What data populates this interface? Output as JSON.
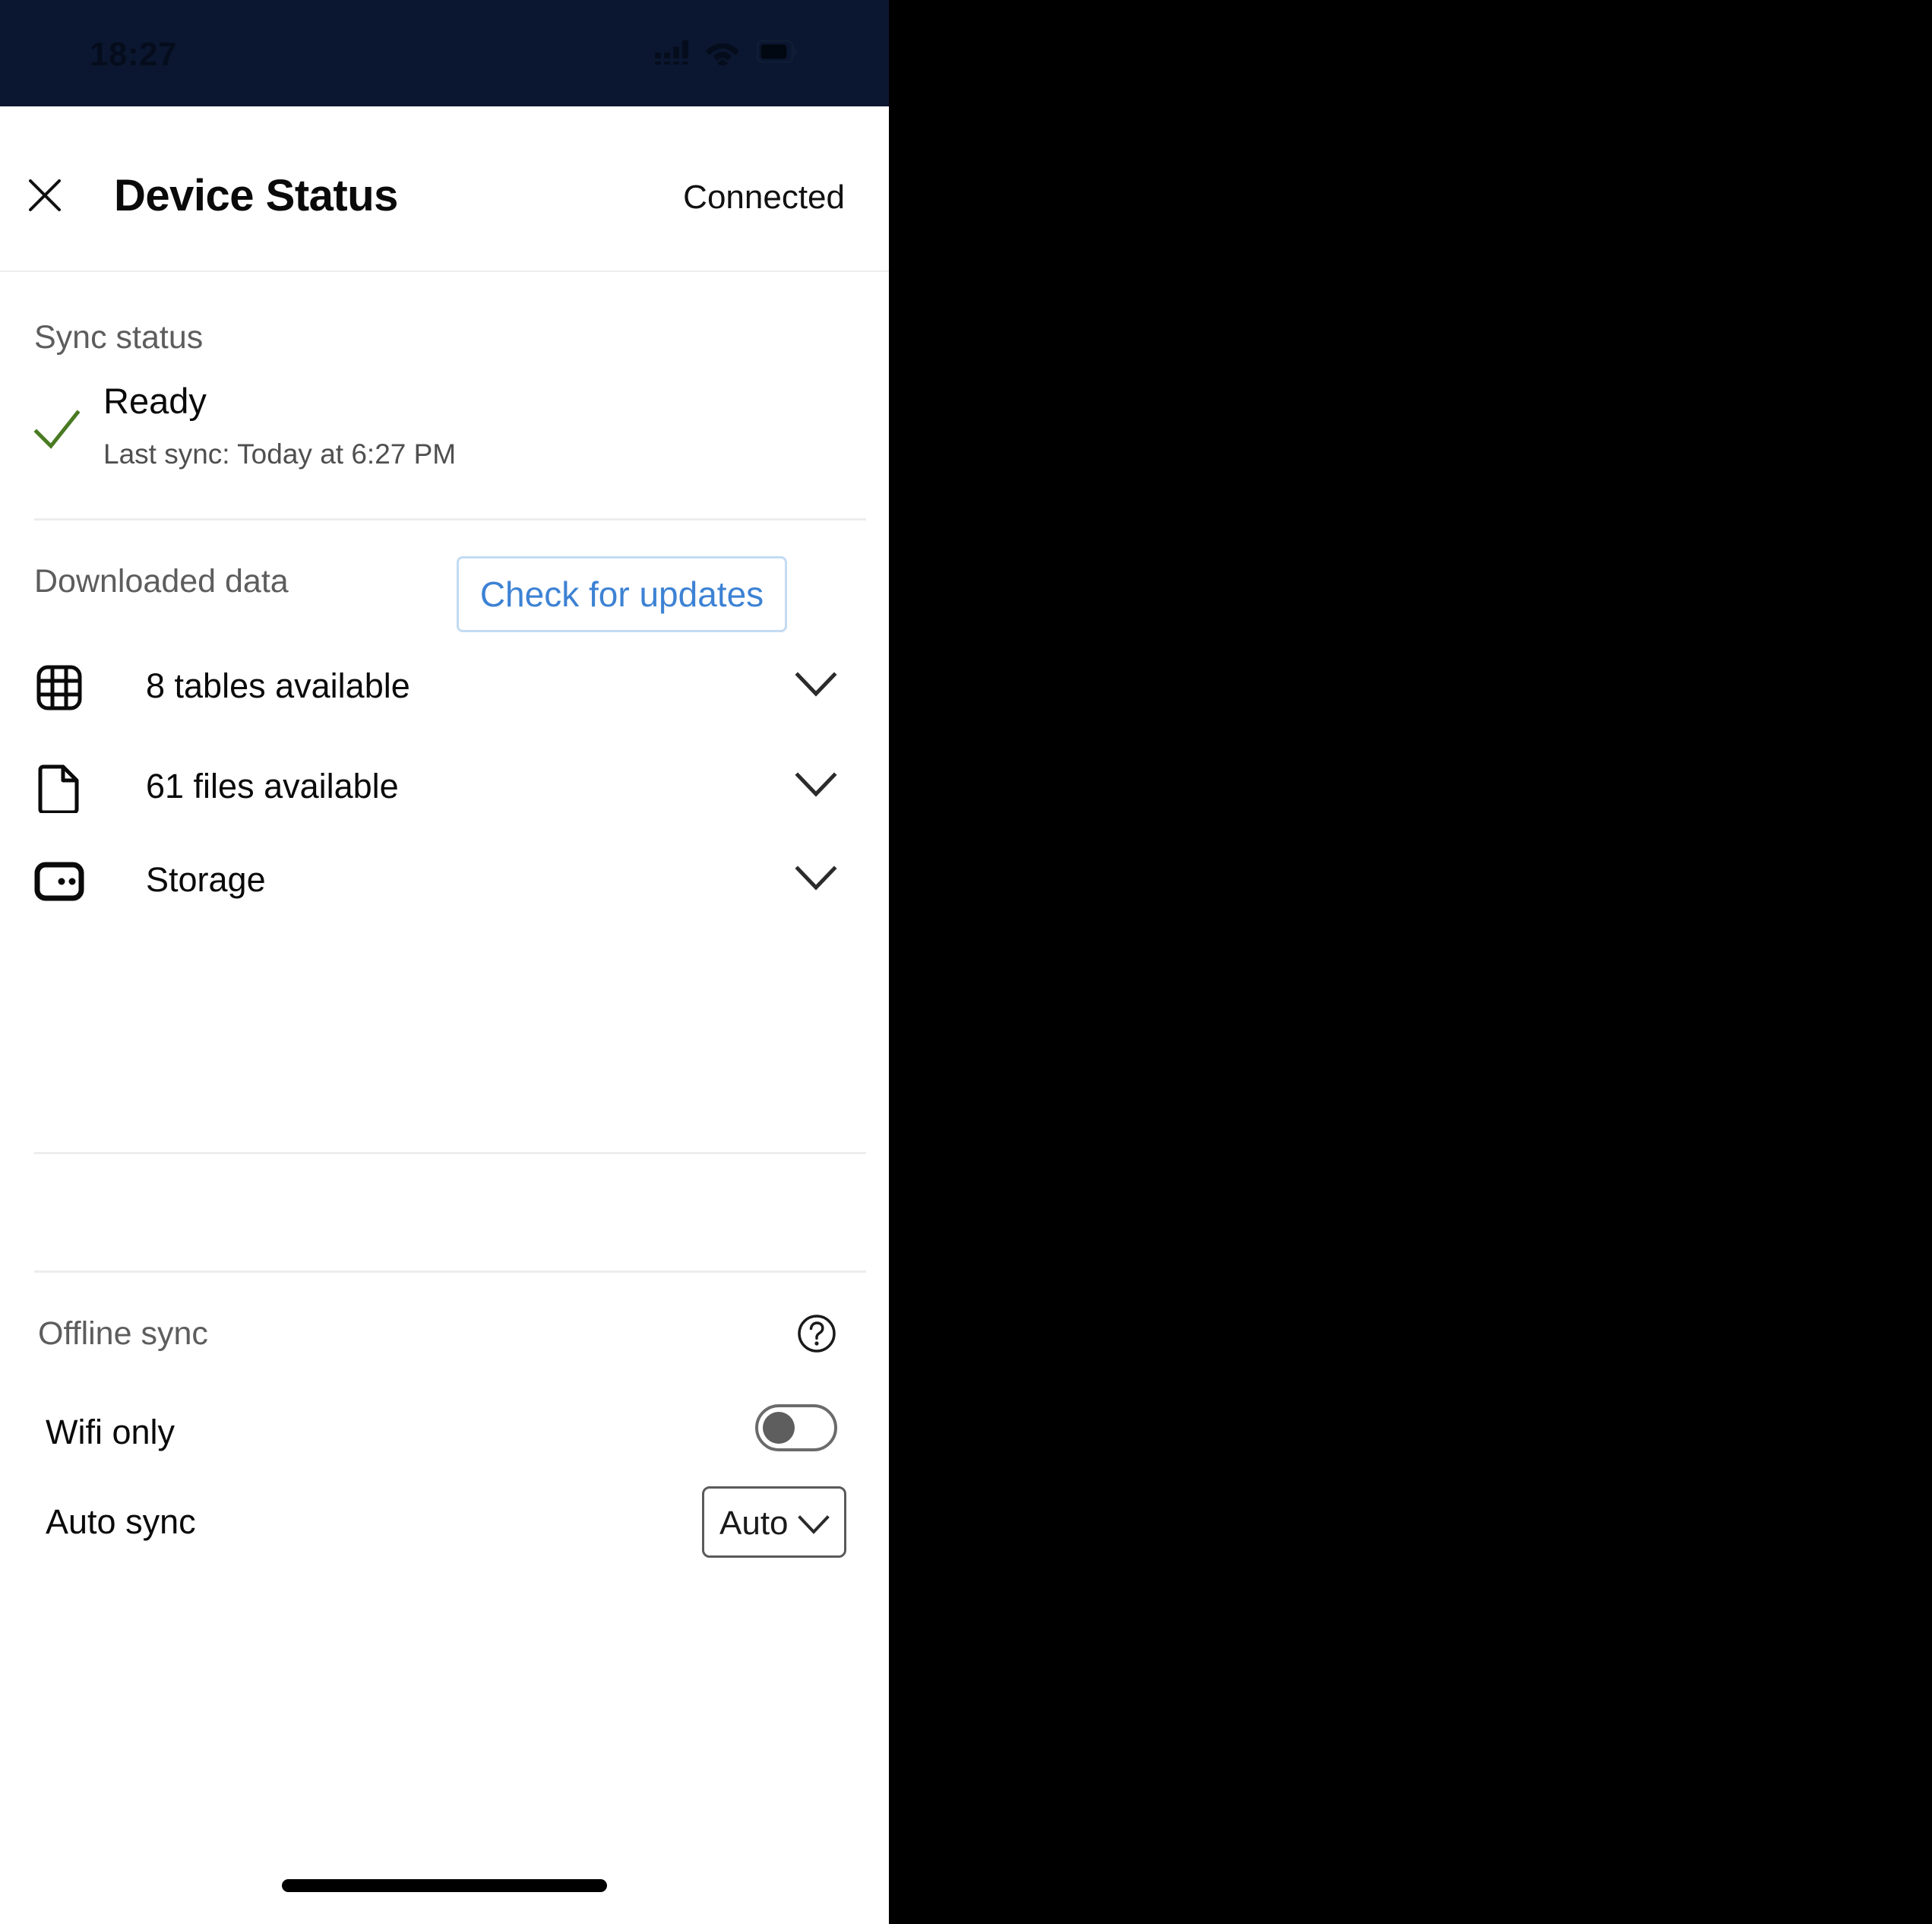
{
  "status_bar": {
    "time": "18:27",
    "icons": [
      "cellular-signal-icon",
      "wifi-icon",
      "battery-icon"
    ]
  },
  "header": {
    "close_label": "close-icon",
    "title": "Device Status",
    "connection_status": "Connected"
  },
  "sync_status": {
    "section_label": "Sync status",
    "state": "Ready",
    "last_sync": "Last sync: Today at 6:27 PM",
    "check_icon": "check-icon",
    "check_color": "#4a7a22"
  },
  "downloaded_data": {
    "section_label": "Downloaded data",
    "check_updates_label": "Check for updates",
    "rows": [
      {
        "icon": "table-grid-icon",
        "label": "8 tables available",
        "chevron": "chevron-down-icon"
      },
      {
        "icon": "file-document-icon",
        "label": "61 files available",
        "chevron": "chevron-down-icon"
      },
      {
        "icon": "storage-drive-icon",
        "label": "Storage",
        "chevron": "chevron-down-icon"
      }
    ]
  },
  "offline_sync": {
    "section_label": "Offline sync",
    "help_icon": "help-circle-icon",
    "wifi_only": {
      "label": "Wifi only",
      "value": "off"
    },
    "auto_sync": {
      "label": "Auto sync",
      "value": "Auto",
      "options": [
        "Auto"
      ],
      "chevron": "chevron-down-icon"
    }
  },
  "colors": {
    "status_bar_bg": "#0b1730",
    "accent_blue": "#3d82d4",
    "button_border": "#c3dbf2",
    "success_green": "#4a7a22",
    "divider": "#ededed"
  }
}
